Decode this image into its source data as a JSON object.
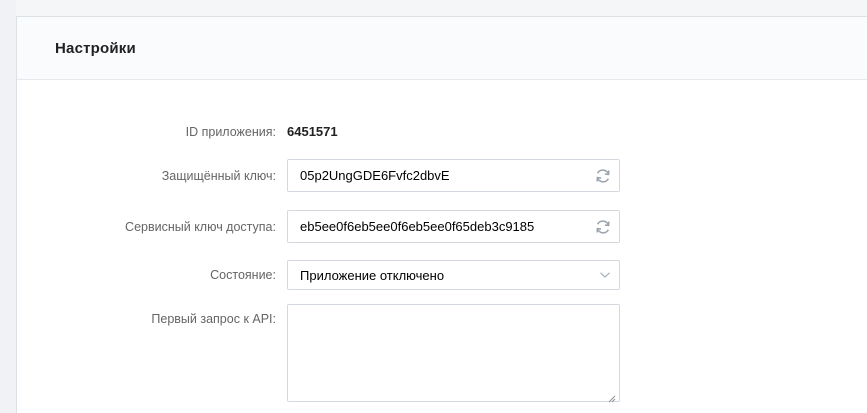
{
  "settings": {
    "title": "Настройки",
    "fields": {
      "app_id": {
        "label": "ID приложения:",
        "value": "6451571"
      },
      "secure_key": {
        "label": "Защищённый ключ:",
        "value": "05p2UngGDE6Fvfc2dbvE",
        "icon": "refresh-icon"
      },
      "service_key": {
        "label": "Сервисный ключ доступа:",
        "value": "eb5ee0f6eb5ee0f6eb5ee0f65deb3c9185",
        "icon": "refresh-icon"
      },
      "status": {
        "label": "Состояние:",
        "value": "Приложение отключено",
        "icon": "chevron-down-icon"
      },
      "first_api_request": {
        "label": "Первый запрос к API:",
        "value": ""
      }
    }
  },
  "colors": {
    "label": "#656565",
    "border": "#d3d9de",
    "header_bg": "#fafbfc",
    "page_bg": "#ebedf0"
  }
}
